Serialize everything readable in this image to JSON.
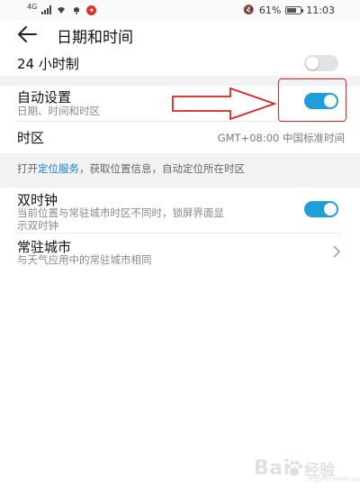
{
  "status_bar": {
    "left_icons": [
      "signal-icon",
      "wifi-icon",
      "bell-icon",
      "app-badge-icon"
    ],
    "network_label": "4G",
    "mute_icon": "🔇",
    "battery_text": "61%",
    "battery_level": 0.61,
    "time": "11:03"
  },
  "header": {
    "back_icon": "arrow-left-icon",
    "title": "日期和时间"
  },
  "settings": {
    "hour24": {
      "label": "24 小时制",
      "toggle": "off"
    },
    "auto_set": {
      "label": "自动设置",
      "sublabel": "日期、时间和时区",
      "toggle": "on"
    },
    "timezone": {
      "label": "时区",
      "value": "GMT+08:00 中国标准时间"
    },
    "location_hint": {
      "prefix": "打开",
      "link": "定位服务",
      "suffix": "，获取位置信息，自动定位所在时区"
    },
    "dual_clock": {
      "label": "双时钟",
      "sublabel_line1": "当前位置与常驻城市时区不同时，锁屏界面显",
      "sublabel_line2": "示双时钟",
      "toggle": "on"
    },
    "home_city": {
      "label": "常驻城市",
      "sublabel": "与天气应用中的常驻城市相同",
      "chevron": ">"
    }
  },
  "colors": {
    "accent": "#1e9fd9",
    "link": "#1e7fd0",
    "annotation_red": "#e02020"
  },
  "watermark": {
    "brand": "Bai",
    "brand_cn": "经验",
    "url": "jingyan.baidu.com"
  }
}
